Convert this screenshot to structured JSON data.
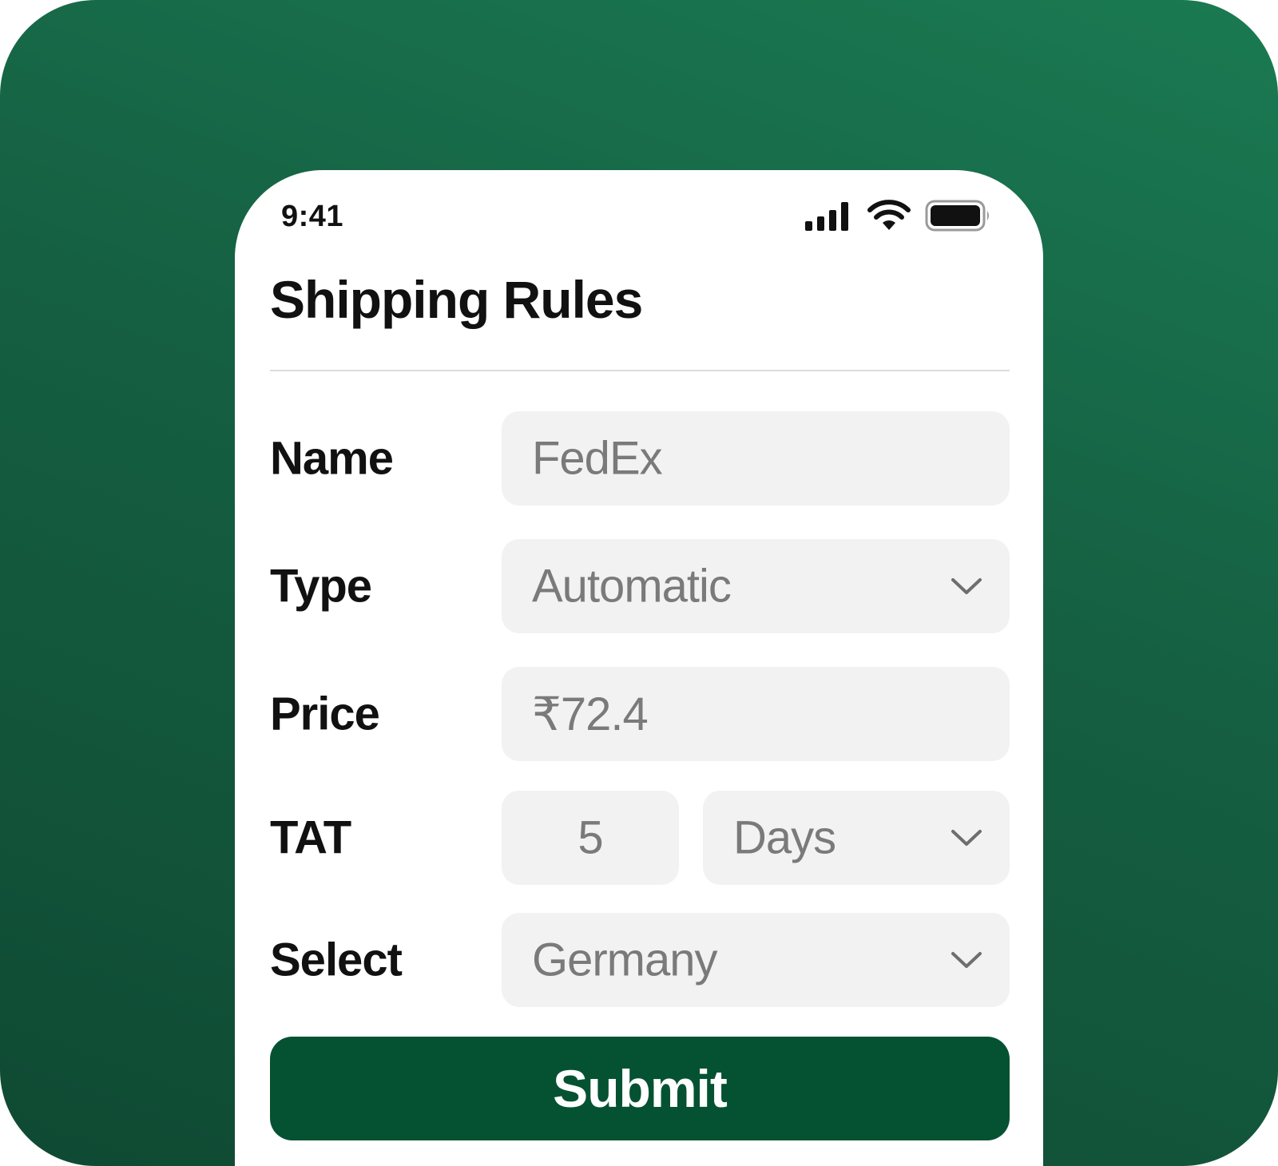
{
  "status_bar": {
    "time": "9:41",
    "icons": [
      "cellular-signal-icon",
      "wifi-icon",
      "battery-icon"
    ]
  },
  "page": {
    "title": "Shipping Rules"
  },
  "form": {
    "name": {
      "label": "Name",
      "value": "FedEx"
    },
    "type": {
      "label": "Type",
      "value": "Automatic",
      "icon": "chevron-down-icon"
    },
    "price": {
      "label": "Price",
      "value": "₹72.4"
    },
    "tat": {
      "label": "TAT",
      "amount": "5",
      "unit": "Days",
      "icon": "chevron-down-icon"
    },
    "select": {
      "label": "Select",
      "value": "Germany",
      "icon": "chevron-down-icon"
    },
    "submit_label": "Submit"
  },
  "colors": {
    "background_gradient_start": "#1a7a52",
    "background_gradient_end": "#0f4a33",
    "accent": "#055232",
    "field_background": "#f2f2f2",
    "field_text": "#7a7a7a",
    "label_text": "#111111"
  }
}
